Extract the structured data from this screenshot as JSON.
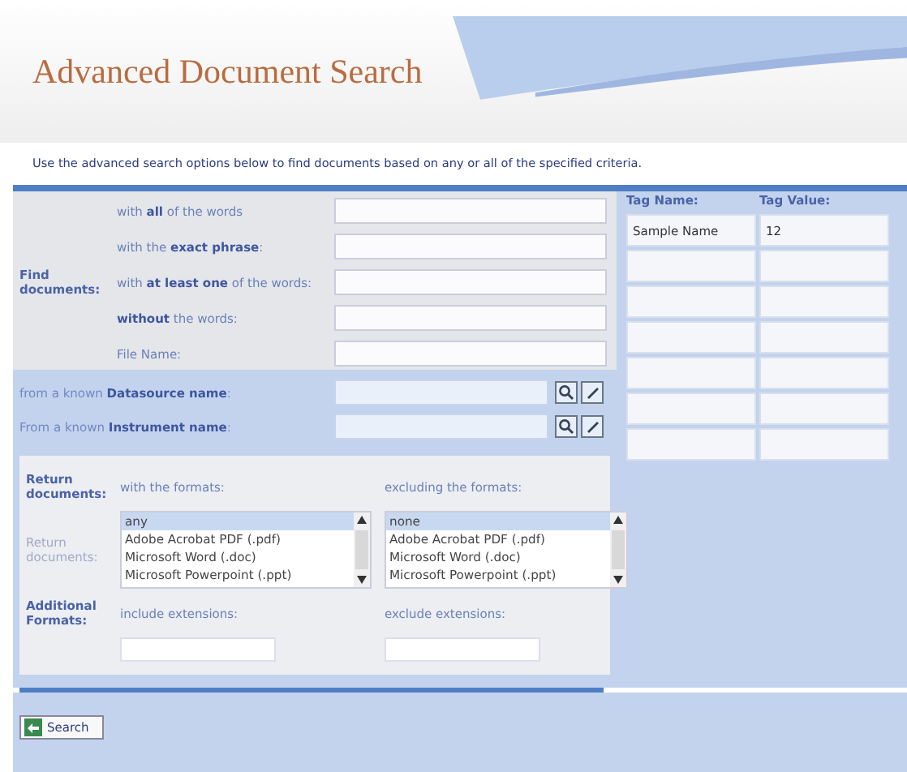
{
  "page": {
    "title": "Advanced Document Search",
    "description": "Use the advanced search options below to find documents based on any or all of the specified criteria."
  },
  "find": {
    "label": "Find documents:",
    "fields": [
      {
        "label": "with **all** of the words"
      },
      {
        "label": "with the **exact phrase**:"
      },
      {
        "label": "with **at least one** of the words:"
      },
      {
        "label": "**without** the words:"
      },
      {
        "label": "File Name:"
      }
    ]
  },
  "known": [
    {
      "label": "from a known **Datasource name**:"
    },
    {
      "label": "From a known **Instrument name**:"
    }
  ],
  "tags": {
    "name_header": "Tag Name:",
    "value_header": "Tag Value:",
    "rows": [
      {
        "kind": "filled",
        "name": "Sample Name",
        "value": "12"
      },
      {
        "kind": "empty"
      },
      {
        "kind": "empty"
      },
      {
        "kind": "empty"
      },
      {
        "kind": "empty"
      },
      {
        "kind": "empty"
      },
      {
        "kind": "empty"
      }
    ]
  },
  "formats": {
    "return_label": "Return documents:",
    "return_label_faded": "Return documents:",
    "with_label": "with the formats:",
    "excluding_label": "excluding the formats:",
    "with_options": [
      {
        "label": "any",
        "selected": true
      },
      {
        "label": "Adobe Acrobat PDF (.pdf)",
        "selected": false
      },
      {
        "label": "Microsoft Word (.doc)",
        "selected": false
      },
      {
        "label": "Microsoft Powerpoint (.ppt)",
        "selected": false
      }
    ],
    "excluding_options": [
      {
        "label": "none",
        "selected": true
      },
      {
        "label": "Adobe Acrobat PDF (.pdf)",
        "selected": false
      },
      {
        "label": "Microsoft Word (.doc)",
        "selected": false
      },
      {
        "label": "Microsoft Powerpoint (.ppt)",
        "selected": false
      }
    ],
    "additional_label": "Additional Formats:",
    "include_label": "include extensions:",
    "exclude_label": "exclude extensions:"
  },
  "search_button": "Search"
}
